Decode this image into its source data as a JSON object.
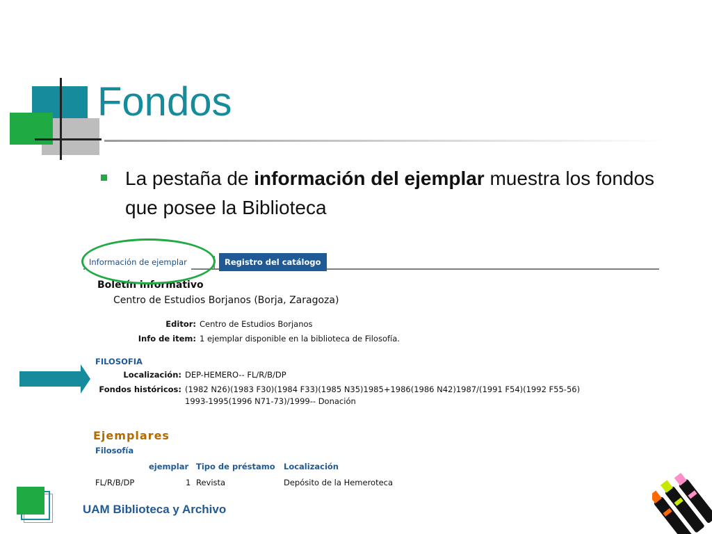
{
  "slide": {
    "title": "Fondos",
    "bullet": {
      "prefix": "La pestaña de ",
      "emphasis": "información del ejemplar",
      "suffix": " muestra los fondos que posee la Biblioteca"
    },
    "footer": "UAM Biblioteca y Archivo"
  },
  "catalog": {
    "tabs": {
      "active": "Información de ejemplar",
      "inactive": "Registro del catálogo"
    },
    "record": {
      "title": "Boletín informativo",
      "subtitle": "Centro de Estudios Borjanos (Borja, Zaragoza)",
      "editor_label": "Editor:",
      "editor_value": "Centro de Estudios Borjanos",
      "info_label": "Info de item:",
      "info_value": "1 ejemplar disponible en la biblioteca de Filosofía."
    },
    "library": {
      "name": "FILOSOFIA",
      "location_label": "Localización:",
      "location_value": "DEP-HEMERO-- FL/R/B/DP",
      "holdings_label": "Fondos históricos:",
      "holdings_line1": "(1982 N26)(1983 F30)(1984 F33)(1985 N35)1985+1986(1986 N42)1987/(1991 F54)(1992 F55-56)",
      "holdings_line2": "1993-1995(1996 N71-73)/1999-- Donación"
    },
    "copies": {
      "heading": "Ejemplares",
      "library": "Filosofía",
      "columns": [
        "ejemplar",
        "Tipo de préstamo",
        "Localización"
      ],
      "row": {
        "signature": "FL/R/B/DP",
        "ejemplar": "1",
        "tipo": "Revista",
        "localizacion": "Depósito de la Hemeroteca"
      }
    }
  },
  "colors": {
    "teal": "#168b9b",
    "green": "#1faa44",
    "blue": "#1f5a96",
    "orange": "#b36b00"
  }
}
